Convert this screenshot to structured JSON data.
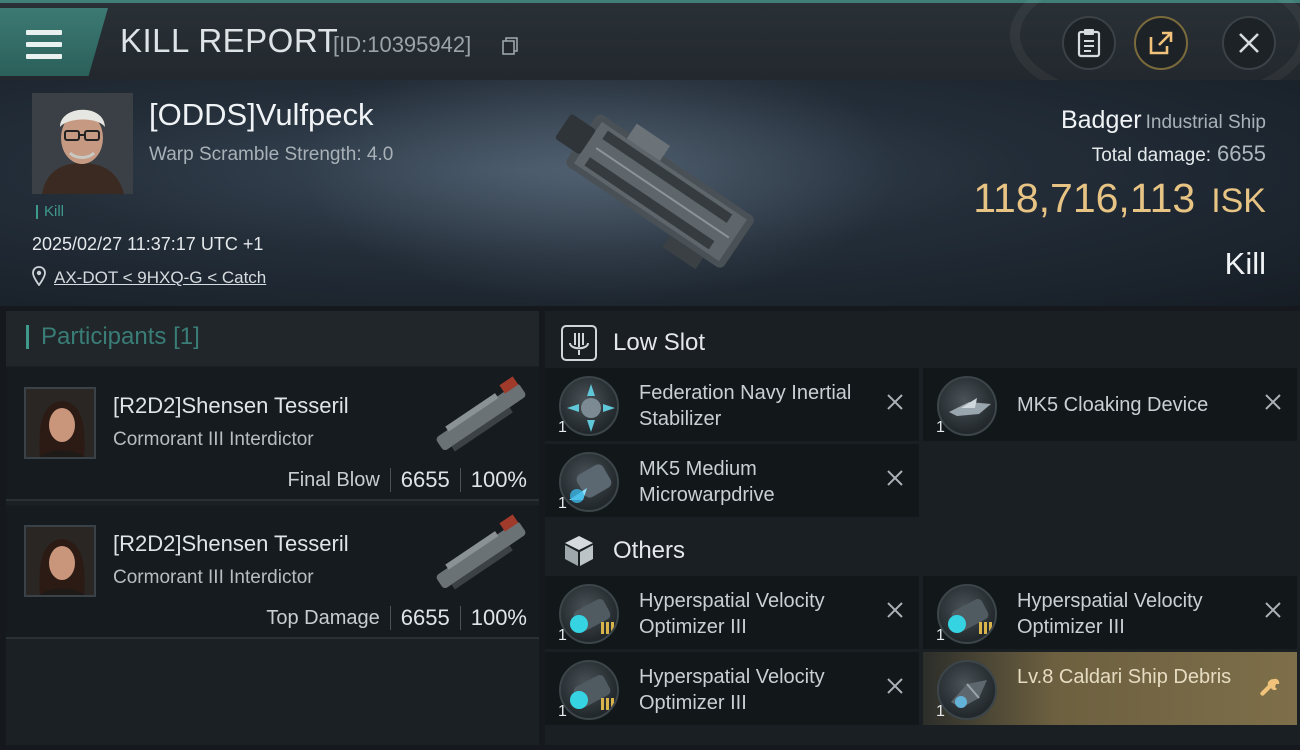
{
  "header": {
    "title": "KILL REPORT",
    "report_id": "[ID:10395942]"
  },
  "victim": {
    "name": "[ODDS]Vulfpeck",
    "warp_scramble": "Warp Scramble Strength: 4.0",
    "tag": "Kill",
    "time": "2025/02/27 11:37:17 UTC +1",
    "location": "AX-DOT < 9HXQ-G < Catch"
  },
  "ship": {
    "name": "Badger",
    "class": "Industrial Ship",
    "total_damage_label": "Total damage:",
    "total_damage": "6655",
    "value": "118,716,113",
    "currency": "ISK",
    "result": "Kill"
  },
  "participants": {
    "title": "Participants",
    "count": "[1]",
    "rows": [
      {
        "name": "[R2D2]Shensen Tesseril",
        "ship": "Cormorant III Interdictor",
        "role": "Final Blow",
        "damage": "6655",
        "percent": "100%"
      },
      {
        "name": "[R2D2]Shensen Tesseril",
        "ship": "Cormorant III Interdictor",
        "role": "Top Damage",
        "damage": "6655",
        "percent": "100%"
      }
    ]
  },
  "low_slot": {
    "label": "Low Slot",
    "items": [
      {
        "name": "Federation Navy Inertial Stabilizer",
        "qty": "1"
      },
      {
        "name": "MK5 Cloaking Device",
        "qty": "1"
      },
      {
        "name": "MK5 Medium Microwarpdrive",
        "qty": "1"
      }
    ]
  },
  "others": {
    "label": "Others",
    "items": [
      {
        "name": "Hyperspatial Velocity Optimizer III",
        "qty": "1"
      },
      {
        "name": "Hyperspatial Velocity Optimizer III",
        "qty": "1"
      },
      {
        "name": "Hyperspatial Velocity Optimizer III",
        "qty": "1"
      },
      {
        "name": "Lv.8 Caldari Ship Debris",
        "qty": "1"
      }
    ]
  },
  "colors": {
    "accent_teal": "#3f9a8b",
    "isk_gold": "#e7c384",
    "highlight_row": "#7e6f4a"
  },
  "icons": {
    "menu": "hamburger-menu-icon",
    "copy": "copy-icon",
    "clipboard": "clipboard-icon",
    "share": "share-icon",
    "close": "close-icon",
    "location": "location-pin-icon",
    "low_slot": "low-slot-icon",
    "others": "cube-icon",
    "remove": "close-x-icon",
    "repair": "wrench-icon"
  }
}
